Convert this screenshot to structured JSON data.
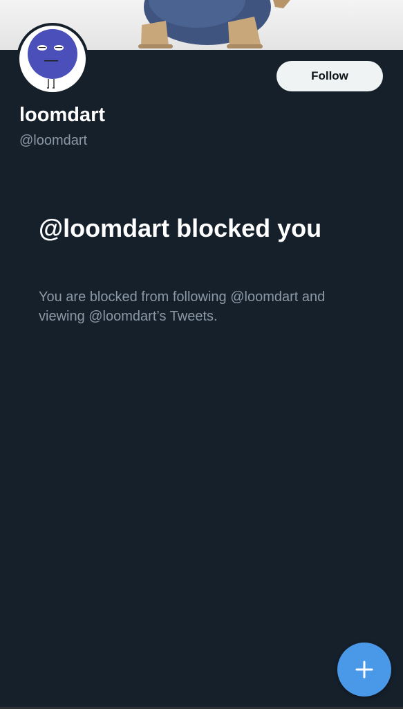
{
  "profile": {
    "display_name": "loomdart",
    "handle": "@loomdart",
    "follow_label": "Follow"
  },
  "blocked": {
    "title": "@loomdart blocked you",
    "description": "You are blocked from following @loomdart and viewing @loomdart’s Tweets."
  },
  "icons": {
    "banner": "banner-image",
    "avatar": "avatar-character",
    "compose": "plus-icon"
  },
  "colors": {
    "background": "#16202b",
    "accent": "#4a99e9",
    "secondary_text": "#8b98a5",
    "follow_button_bg": "#eff3f4"
  }
}
